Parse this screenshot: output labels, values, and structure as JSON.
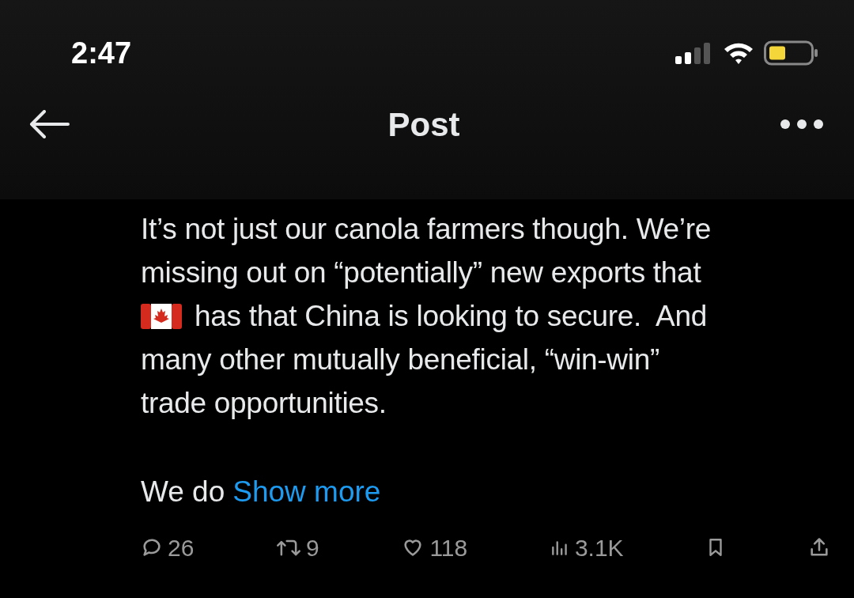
{
  "status_bar": {
    "time": "2:47"
  },
  "header": {
    "title": "Post"
  },
  "post": {
    "lines": [
      {
        "flag": false,
        "text": "It’s not just our canola farmers though. We’re"
      },
      {
        "flag": false,
        "text": "missing out on “potentially” new exports that"
      },
      {
        "flag": true,
        "text": "has that China is looking to secure.  And"
      },
      {
        "flag": false,
        "text": "many other mutually beneficial, “win-win”"
      },
      {
        "flag": false,
        "text": "trade opportunities."
      }
    ],
    "teaser": "We do",
    "show_more": "Show more"
  },
  "actions": [
    {
      "kind": "reply",
      "count": "26"
    },
    {
      "kind": "repost",
      "count": "9"
    },
    {
      "kind": "like",
      "count": "118"
    },
    {
      "kind": "views",
      "count": "3.1K"
    },
    {
      "kind": "bookmark"
    },
    {
      "kind": "share"
    }
  ]
}
